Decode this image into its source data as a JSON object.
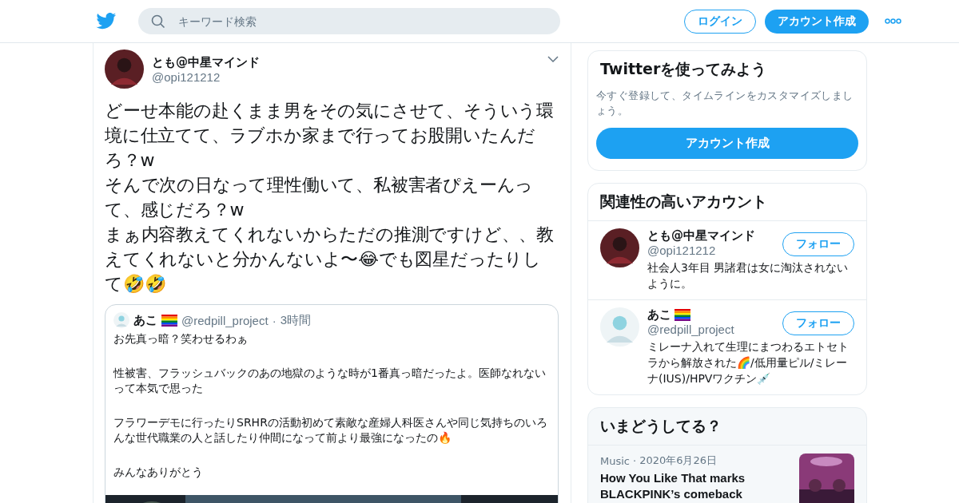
{
  "header": {
    "search": {
      "placeholder": "キーワード検索"
    },
    "login": "ログイン",
    "signup": "アカウント作成"
  },
  "tweet": {
    "name": "とも@中星マインド",
    "handle": "@opi121212",
    "text": "どーせ本能の赴くまま男をその気にさせて、そういう環境に仕立てて、ラブホか家まで行ってお股開いたんだろ？w\nそんで次の日なって理性働いて、私被害者ぴえーんって、感じだろ？w\nまぁ内容教えてくれないからただの推測ですけど、、教えてくれないと分かんないよ〜😂でも図星だったりして🤣🤣",
    "quote": {
      "name": "あこ",
      "handle": "@redpill_project",
      "separator": "·",
      "time": "3時間",
      "paragraphs": [
        "お先真っ暗？笑わせるわぁ",
        "性被害、フラッシュバックのあの地獄のような時が1番真っ暗だったよ。医師なれないって本気で思った",
        "フラワーデモに行ったりSRHRの活動初めて素敵な産婦人科医さんや同じ気持ちのいろんな世代職業の人と話したり仲間になって前より最強になったの🔥",
        "みんなありがとう"
      ]
    }
  },
  "signup_card": {
    "title": "Twitterを使ってみよう",
    "text": "今すぐ登録して、タイムラインをカスタマイズしましょう。",
    "button": "アカウント作成"
  },
  "related": {
    "title": "関連性の高いアカウント",
    "accounts": [
      {
        "name": "とも@中星マインド",
        "handle": "@opi121212",
        "bio": "社会人3年目 男諸君は女に淘汰されないように。",
        "follow": "フォロー",
        "flag": false
      },
      {
        "name": "あこ",
        "handle": "@redpill_project",
        "bio": "ミレーナ入れて生理にまつわるエトセトラから解放された🌈/低用量ピル/ミレーナ(IUS)/HPVワクチン💉",
        "follow": "フォロー",
        "flag": true
      }
    ]
  },
  "trends": {
    "title": "いまどうしてる？",
    "items": [
      {
        "category": "Music",
        "separator": "·",
        "date": "2020年6月26日",
        "headline": "How You Like That marks BLACKPINK’s comeback"
      }
    ]
  }
}
